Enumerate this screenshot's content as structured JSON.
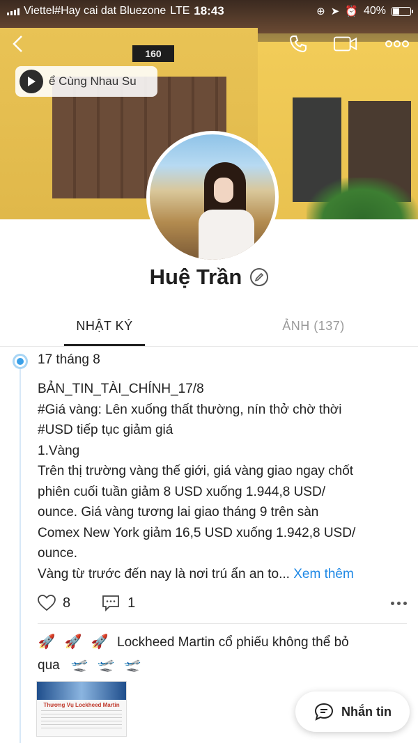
{
  "status_bar": {
    "carrier": "Viettel#Hay cai dat Bluezone",
    "network": "LTE",
    "time": "18:43",
    "battery": "40%",
    "battery_level": 0.4
  },
  "music": {
    "text": "ể Cùng Nhau Su"
  },
  "cover": {
    "sign": "160"
  },
  "profile": {
    "name": "Huệ Trần"
  },
  "tabs": [
    {
      "label": "NHẬT KÝ",
      "active": true
    },
    {
      "label": "ẢNH (137)",
      "active": false
    }
  ],
  "post": {
    "date": "17 tháng 8",
    "lines": [
      "BẢN_TIN_TÀI_CHÍNH_17/8",
      "#Giá vàng: Lên xuống thất thường, nín thở chờ thời",
      "#USD tiếp tục giảm giá",
      "1.Vàng",
      "Trên thị trường vàng thế giới, giá vàng giao ngay chốt",
      "phiên cuối tuần giảm 8 USD xuống 1.944,8 USD/",
      "ounce. Giá vàng tương lai giao tháng 9 trên sàn",
      "Comex New York giảm 16,5 USD xuống 1.942,8 USD/",
      "ounce."
    ],
    "last_line": "Vàng từ trước đến nay là nơi trú ẩn an to...",
    "see_more": "Xem thêm",
    "likes": "8",
    "comments": "1"
  },
  "post2": {
    "line1": "Lockheed Martin cổ phiếu không thể bỏ",
    "line2": "qua",
    "thumb_title": "Thương Vụ Lockheed Martin"
  },
  "chat_button": {
    "label": "Nhắn tin"
  },
  "colors": {
    "accent": "#1e88e5",
    "timeline": "#3aa0e8"
  }
}
